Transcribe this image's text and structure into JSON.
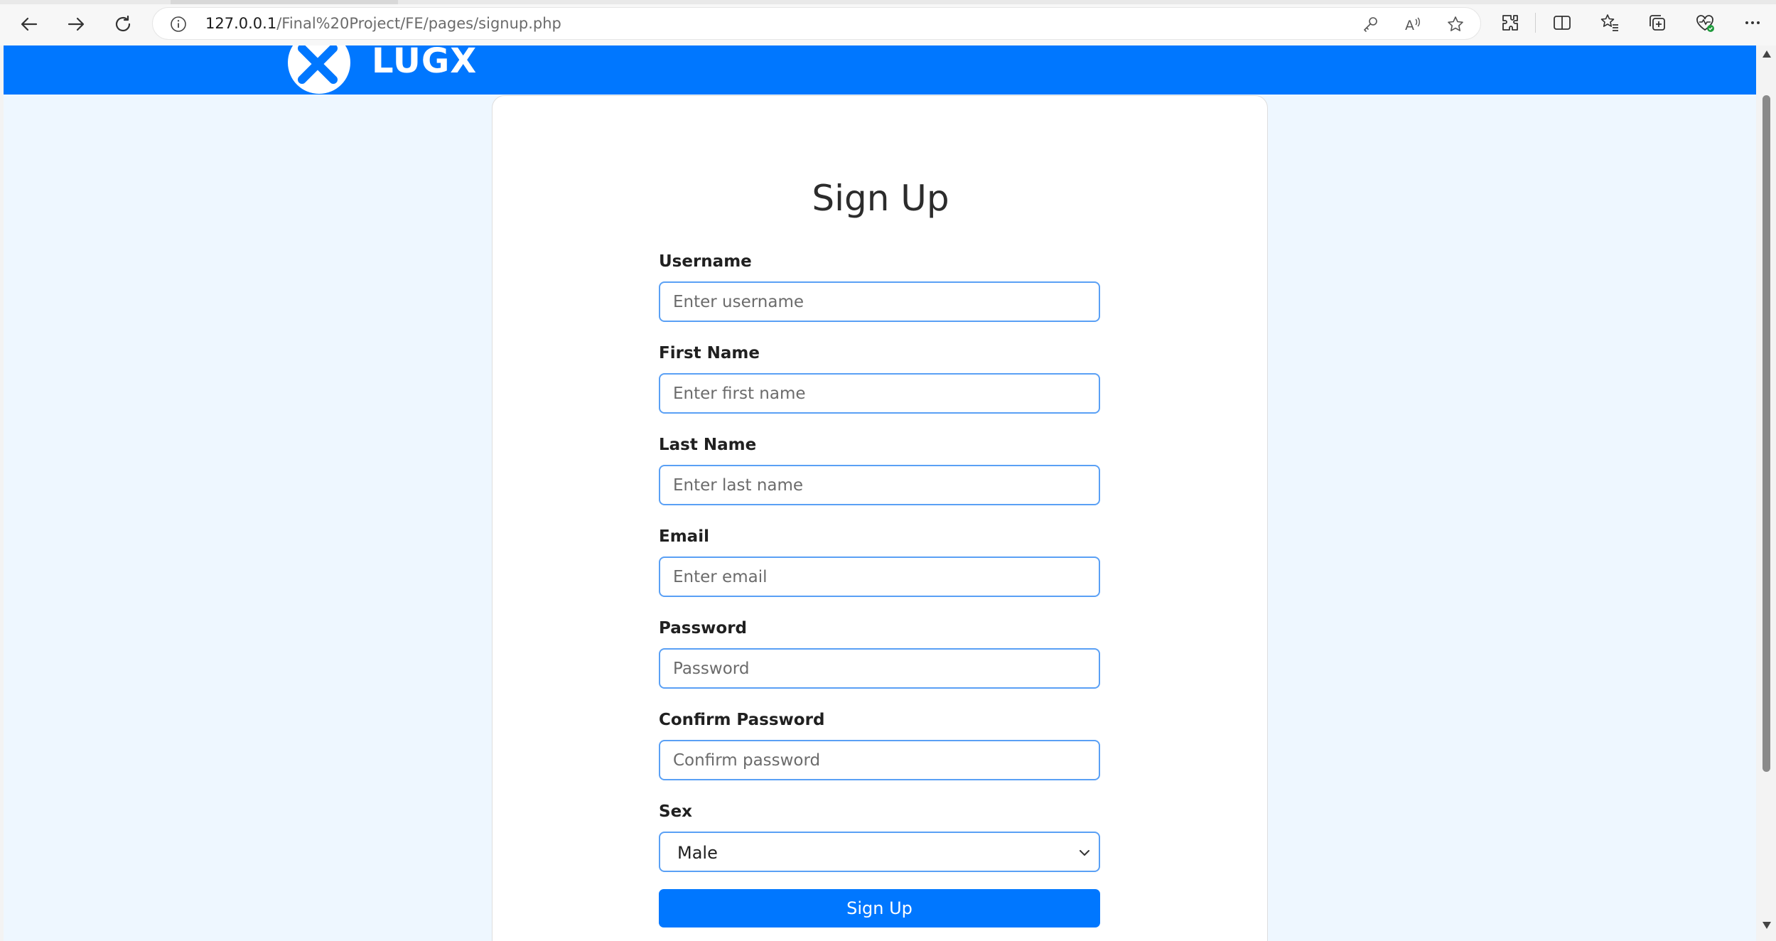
{
  "browser": {
    "url_host": "127.0.0.1",
    "url_path": "/Final%20Project/FE/pages/signup.php",
    "icons": [
      "back-icon",
      "forward-icon",
      "refresh-icon",
      "info-icon",
      "key-icon",
      "read-aloud-icon",
      "favorite-star-icon",
      "extensions-icon",
      "split-screen-icon",
      "favorites-icon",
      "collections-icon",
      "browser-essentials-icon",
      "more-icon"
    ]
  },
  "site": {
    "brand": "LUGX",
    "header_color": "#0077ff",
    "background_color": "#eef7ff"
  },
  "signup_form": {
    "title": "Sign Up",
    "fields": [
      {
        "label": "Username",
        "placeholder": "Enter username"
      },
      {
        "label": "First Name",
        "placeholder": "Enter first name"
      },
      {
        "label": "Last Name",
        "placeholder": "Enter last name"
      },
      {
        "label": "Email",
        "placeholder": "Enter email"
      },
      {
        "label": "Password",
        "placeholder": "Password"
      },
      {
        "label": "Confirm Password",
        "placeholder": "Confirm password"
      }
    ],
    "sex": {
      "label": "Sex",
      "selected": "Male"
    },
    "submit_label": "Sign Up",
    "accent_color": "#0077ff",
    "input_border_color": "#5aa0f5"
  }
}
